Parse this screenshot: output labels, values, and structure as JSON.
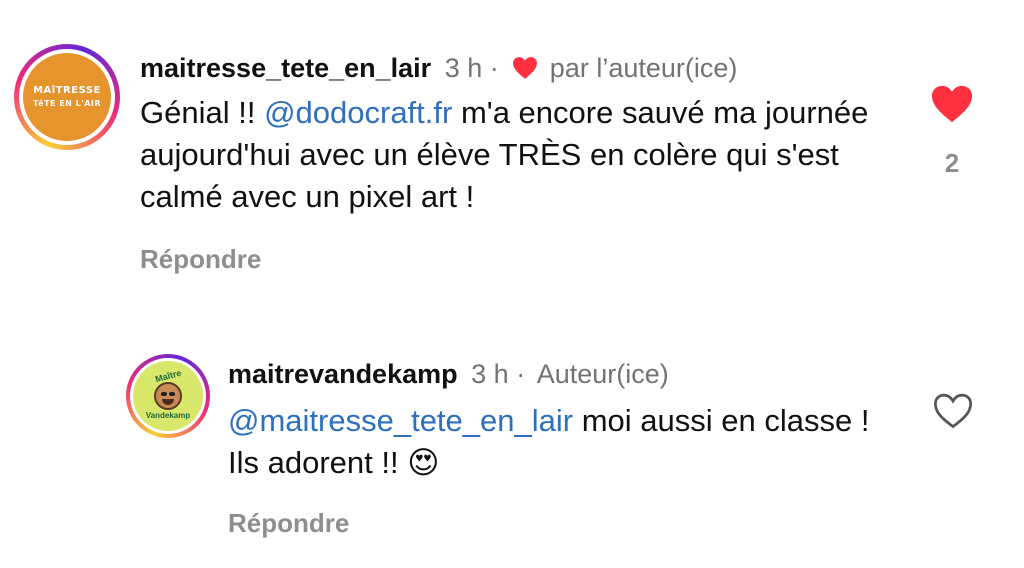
{
  "comments": [
    {
      "username": "maitresse_tete_en_lair",
      "time": "3 h",
      "separator": "·",
      "author_note": "par l’auteur(ice)",
      "avatar": {
        "line1": "MAîTRESSE",
        "line2": "TêTE EN L'AIR",
        "bg": "#e6952e"
      },
      "text_parts": [
        "Génial !! ",
        "@dodocraft.fr",
        " m'a encore sauvé ma journée aujourd'hui avec un élève TRÈS en colère qui s'est calmé avec un pixel art !"
      ],
      "reply_label": "Répondre",
      "liked": true,
      "like_count": "2"
    },
    {
      "username": "maitrevandekamp",
      "time": "3 h",
      "separator": "·",
      "author_note": "Auteur(ice)",
      "avatar": {
        "top": "Maître",
        "bottom": "Vandekamp",
        "bg": "#d9e86a"
      },
      "text_parts": [
        "@maitresse_tete_en_lair",
        " moi aussi en classe ! Ils adorent !! ",
        "😍"
      ],
      "reply_label": "Répondre",
      "liked": false
    }
  ],
  "colors": {
    "heart_red": "#ff3040",
    "mention_blue": "#2f6fbf",
    "muted": "#737373"
  }
}
